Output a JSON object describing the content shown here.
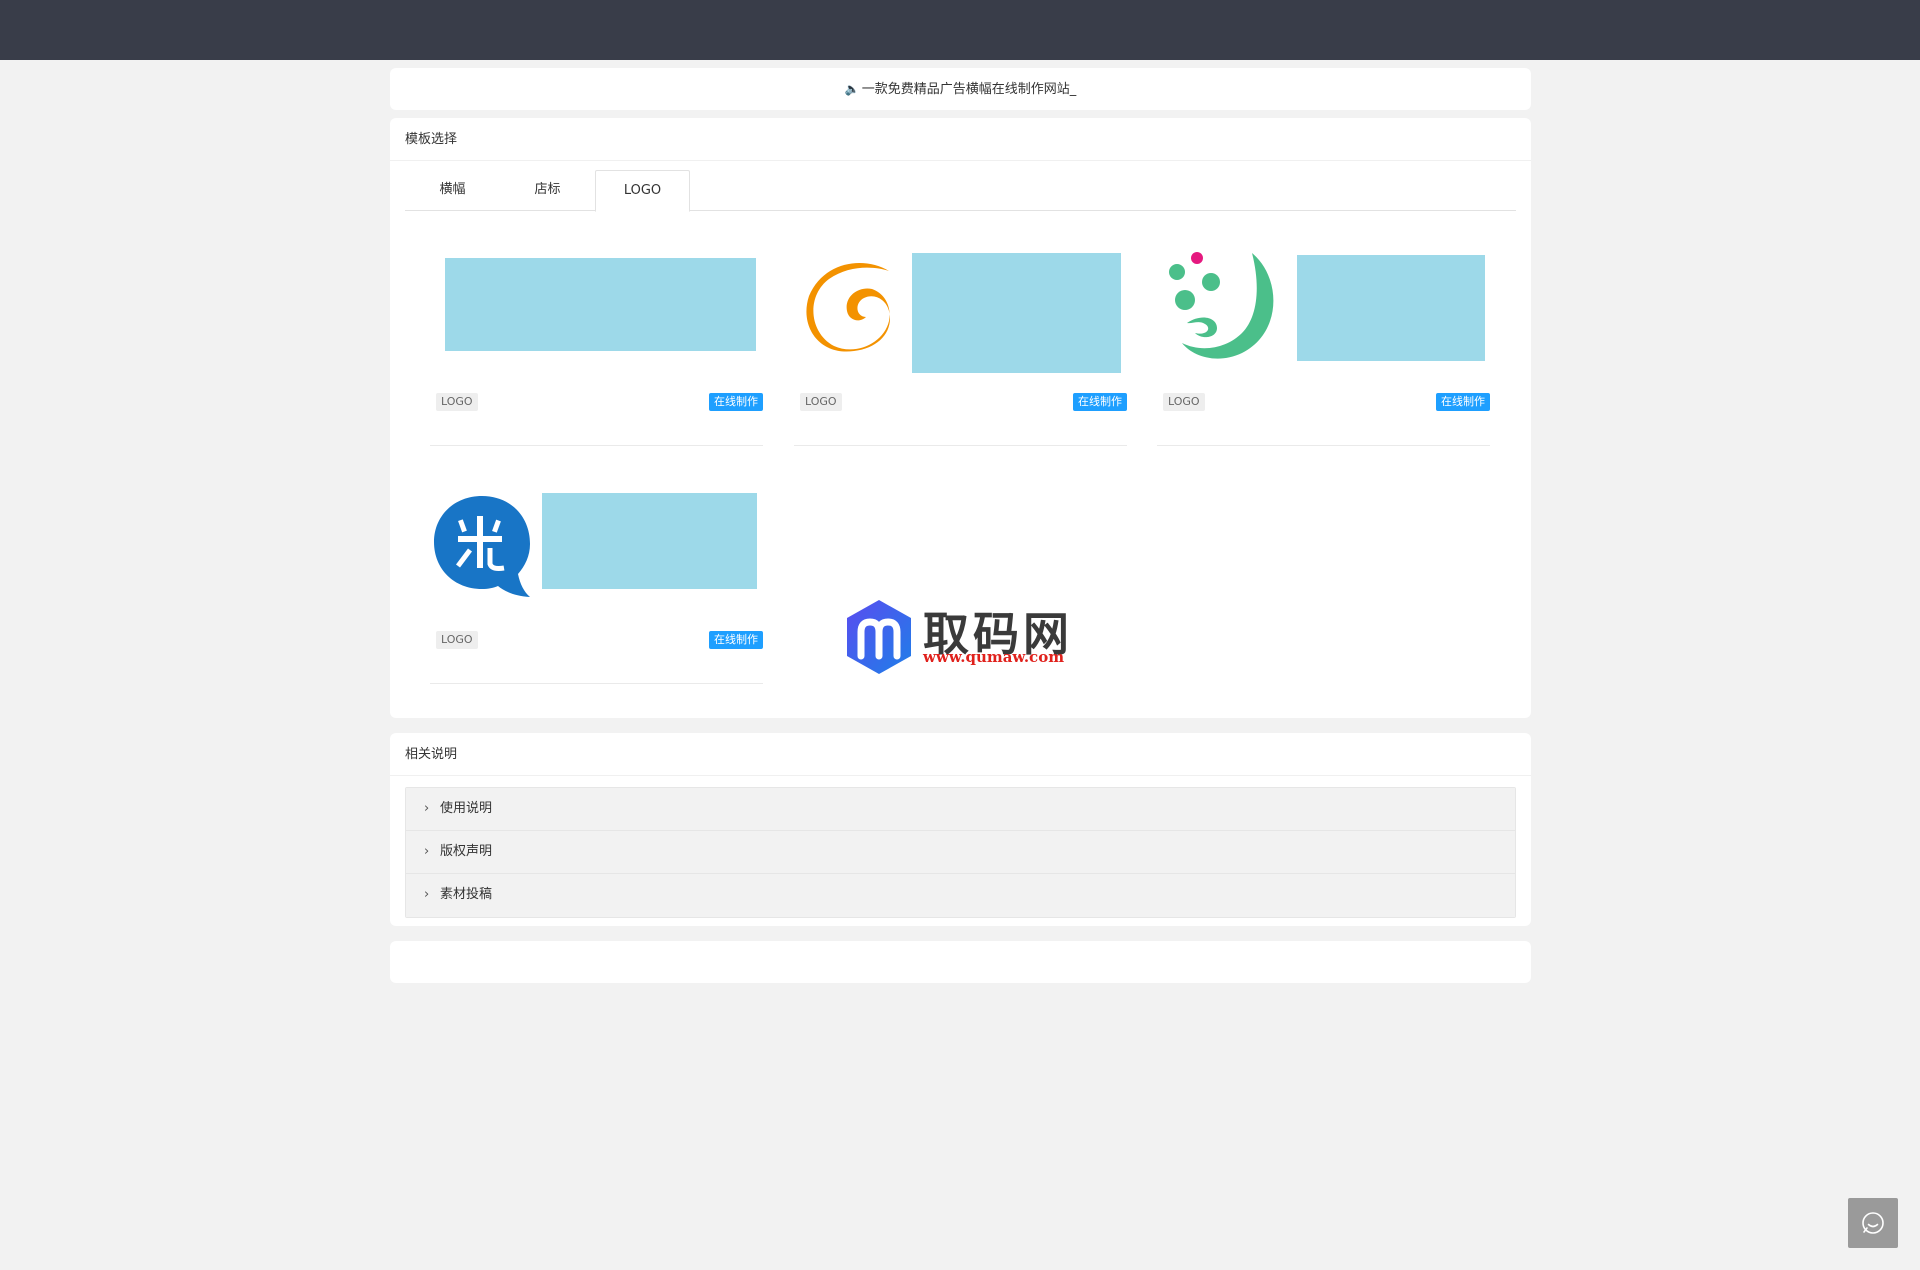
{
  "notice": {
    "speaker_icon": "speaker-icon",
    "text": "一款免费精品广告横幅在线制作网站",
    "caret": "_"
  },
  "templates": {
    "title": "模板选择",
    "tabs": [
      {
        "label": "横幅",
        "active": false
      },
      {
        "label": "店标",
        "active": false
      },
      {
        "label": "LOGO",
        "active": true
      }
    ],
    "items": [
      {
        "tag": "LOGO",
        "action": "在线制作",
        "logo": "none"
      },
      {
        "tag": "LOGO",
        "action": "在线制作",
        "logo": "orange-swirl-icon"
      },
      {
        "tag": "LOGO",
        "action": "在线制作",
        "logo": "green-dots-icon"
      },
      {
        "tag": "LOGO",
        "action": "在线制作",
        "logo": "blue-mi-icon"
      }
    ]
  },
  "watermark": {
    "title": "取码网",
    "url": "www.qumaw.com"
  },
  "notes": {
    "title": "相关说明",
    "items": [
      "使用说明",
      "版权声明",
      "素材投稿"
    ]
  },
  "help": {
    "icon": "chat-smile-icon"
  },
  "colors": {
    "topbar": "#393d49",
    "accent": "#1e9fff",
    "placeholder": "#9dd9e9"
  }
}
